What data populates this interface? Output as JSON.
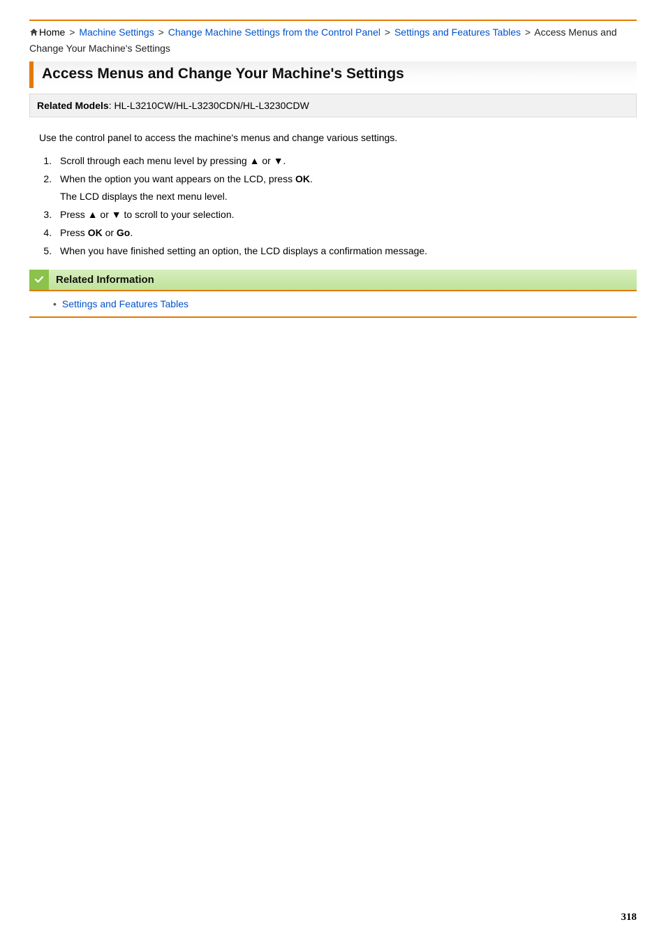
{
  "breadcrumb": {
    "home": "Home",
    "items": [
      "Machine Settings",
      "Change Machine Settings from the Control Panel",
      "Settings and Features Tables"
    ],
    "current": "Access Menus and Change Your Machine's Settings",
    "sep": ">"
  },
  "heading": "Access Menus and Change Your Machine's Settings",
  "models": {
    "label": "Related Models",
    "value": ": HL-L3210CW/HL-L3230CDN/HL-L3230CDW"
  },
  "intro": "Use the control panel to access the machine's menus and change various settings.",
  "steps": {
    "s1a": "Scroll through each menu level by pressing ",
    "s1b": "▲",
    "s1c": " or ",
    "s1d": "▼",
    "s1e": ".",
    "s2a": "When the option you want appears on the LCD, press ",
    "s2b": "OK",
    "s2c": ".",
    "s2sub": "The LCD displays the next menu level.",
    "s3a": "Press ",
    "s3b": "▲",
    "s3c": " or ",
    "s3d": "▼",
    "s3e": " to scroll to your selection.",
    "s4a": "Press ",
    "s4b": "OK",
    "s4c": " or ",
    "s4d": "Go",
    "s4e": ".",
    "s5": "When you have finished setting an option, the LCD displays a confirmation message."
  },
  "related": {
    "title": "Related Information",
    "links": [
      "Settings and Features Tables"
    ]
  },
  "page_number": "318"
}
